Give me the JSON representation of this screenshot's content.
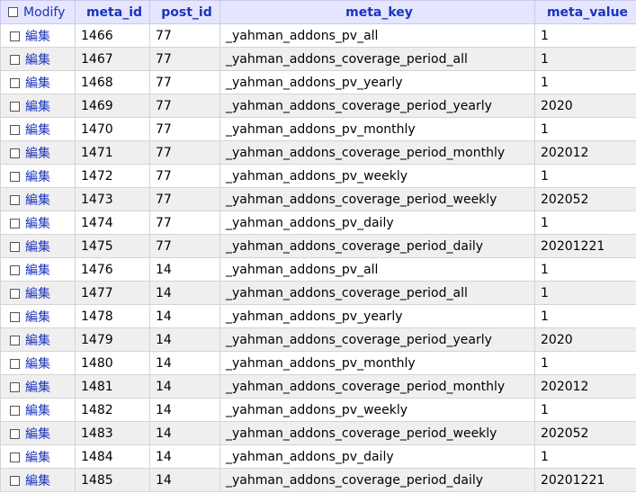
{
  "colors": {
    "header_bg": "#e5e5fd",
    "header_text": "#1b35bb",
    "link": "#1b35bb",
    "row_alt": "#efefef",
    "row": "#ffffff"
  },
  "header": {
    "modify": "Modify",
    "columns": [
      "meta_id",
      "post_id",
      "meta_key",
      "meta_value"
    ]
  },
  "rows": [
    {
      "edit": "編集",
      "meta_id": "1466",
      "post_id": "77",
      "meta_key": "_yahman_addons_pv_all",
      "meta_value": "1"
    },
    {
      "edit": "編集",
      "meta_id": "1467",
      "post_id": "77",
      "meta_key": "_yahman_addons_coverage_period_all",
      "meta_value": "1"
    },
    {
      "edit": "編集",
      "meta_id": "1468",
      "post_id": "77",
      "meta_key": "_yahman_addons_pv_yearly",
      "meta_value": "1"
    },
    {
      "edit": "編集",
      "meta_id": "1469",
      "post_id": "77",
      "meta_key": "_yahman_addons_coverage_period_yearly",
      "meta_value": "2020"
    },
    {
      "edit": "編集",
      "meta_id": "1470",
      "post_id": "77",
      "meta_key": "_yahman_addons_pv_monthly",
      "meta_value": "1"
    },
    {
      "edit": "編集",
      "meta_id": "1471",
      "post_id": "77",
      "meta_key": "_yahman_addons_coverage_period_monthly",
      "meta_value": "202012"
    },
    {
      "edit": "編集",
      "meta_id": "1472",
      "post_id": "77",
      "meta_key": "_yahman_addons_pv_weekly",
      "meta_value": "1"
    },
    {
      "edit": "編集",
      "meta_id": "1473",
      "post_id": "77",
      "meta_key": "_yahman_addons_coverage_period_weekly",
      "meta_value": "202052"
    },
    {
      "edit": "編集",
      "meta_id": "1474",
      "post_id": "77",
      "meta_key": "_yahman_addons_pv_daily",
      "meta_value": "1"
    },
    {
      "edit": "編集",
      "meta_id": "1475",
      "post_id": "77",
      "meta_key": "_yahman_addons_coverage_period_daily",
      "meta_value": "20201221"
    },
    {
      "edit": "編集",
      "meta_id": "1476",
      "post_id": "14",
      "meta_key": "_yahman_addons_pv_all",
      "meta_value": "1"
    },
    {
      "edit": "編集",
      "meta_id": "1477",
      "post_id": "14",
      "meta_key": "_yahman_addons_coverage_period_all",
      "meta_value": "1"
    },
    {
      "edit": "編集",
      "meta_id": "1478",
      "post_id": "14",
      "meta_key": "_yahman_addons_pv_yearly",
      "meta_value": "1"
    },
    {
      "edit": "編集",
      "meta_id": "1479",
      "post_id": "14",
      "meta_key": "_yahman_addons_coverage_period_yearly",
      "meta_value": "2020"
    },
    {
      "edit": "編集",
      "meta_id": "1480",
      "post_id": "14",
      "meta_key": "_yahman_addons_pv_monthly",
      "meta_value": "1"
    },
    {
      "edit": "編集",
      "meta_id": "1481",
      "post_id": "14",
      "meta_key": "_yahman_addons_coverage_period_monthly",
      "meta_value": "202012"
    },
    {
      "edit": "編集",
      "meta_id": "1482",
      "post_id": "14",
      "meta_key": "_yahman_addons_pv_weekly",
      "meta_value": "1"
    },
    {
      "edit": "編集",
      "meta_id": "1483",
      "post_id": "14",
      "meta_key": "_yahman_addons_coverage_period_weekly",
      "meta_value": "202052"
    },
    {
      "edit": "編集",
      "meta_id": "1484",
      "post_id": "14",
      "meta_key": "_yahman_addons_pv_daily",
      "meta_value": "1"
    },
    {
      "edit": "編集",
      "meta_id": "1485",
      "post_id": "14",
      "meta_key": "_yahman_addons_coverage_period_daily",
      "meta_value": "20201221"
    }
  ]
}
